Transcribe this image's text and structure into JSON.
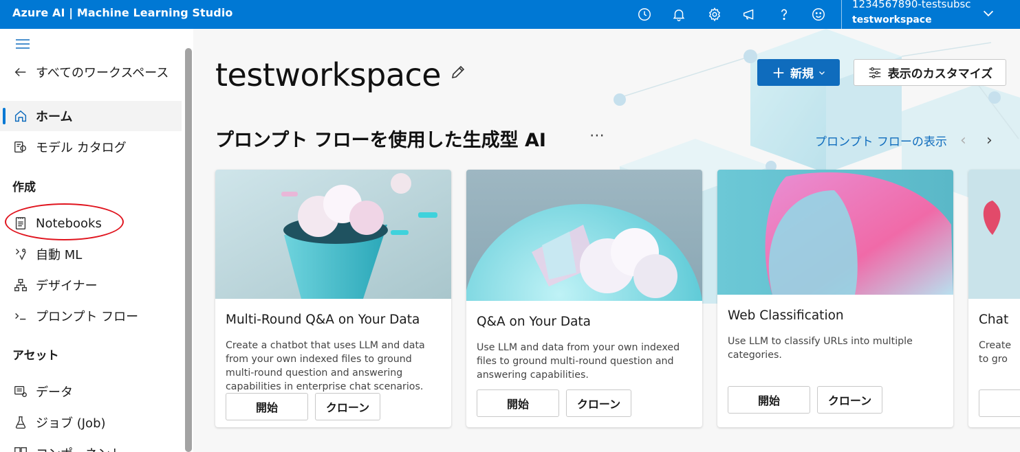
{
  "app": {
    "title": "Azure AI | Machine Learning Studio"
  },
  "account": {
    "subscription": "1234567890-testsubsc",
    "workspace": "testworkspace"
  },
  "topbar_icons": [
    "history-icon",
    "bell-icon",
    "gear-icon",
    "megaphone-icon",
    "help-icon",
    "smiley-icon"
  ],
  "sidebar": {
    "back": "すべてのワークスペース",
    "home": "ホーム",
    "catalog": "モデル カタログ",
    "section_create": "作成",
    "notebooks": "Notebooks",
    "automl": "自動 ML",
    "designer": "デザイナー",
    "promptflow": "プロンプト フロー",
    "section_assets": "アセット",
    "data": "データ",
    "jobs": "ジョブ (Job)",
    "components": "コンポーネント"
  },
  "main": {
    "title": "testworkspace",
    "new_button": "新規",
    "customize_button": "表示のカスタマイズ",
    "section_title": "プロンプト フローを使用した生成型 AI",
    "more": "⋯",
    "view_link": "プロンプト フローの表示"
  },
  "cards": [
    {
      "title": "Multi-Round Q&A on Your Data",
      "desc": "Create a chatbot that uses LLM and data from your own indexed files to ground multi-round question and answering capabilities in enterprise chat scenarios.",
      "start": "開始",
      "clone": "クローン"
    },
    {
      "title": "Q&A on Your Data",
      "desc": "Use LLM and data from your own indexed files to ground multi-round question and answering capabilities.",
      "start": "開始",
      "clone": "クローン"
    },
    {
      "title": "Web Classification",
      "desc": "Use LLM to classify URLs into multiple categories.",
      "start": "開始",
      "clone": "クローン"
    },
    {
      "title": "Chat",
      "desc": "Create to gro",
      "start": "",
      "clone": ""
    }
  ],
  "colors": {
    "brand": "#0078d4",
    "primary_button": "#0f6cbd",
    "annotation": "#e0141e"
  }
}
